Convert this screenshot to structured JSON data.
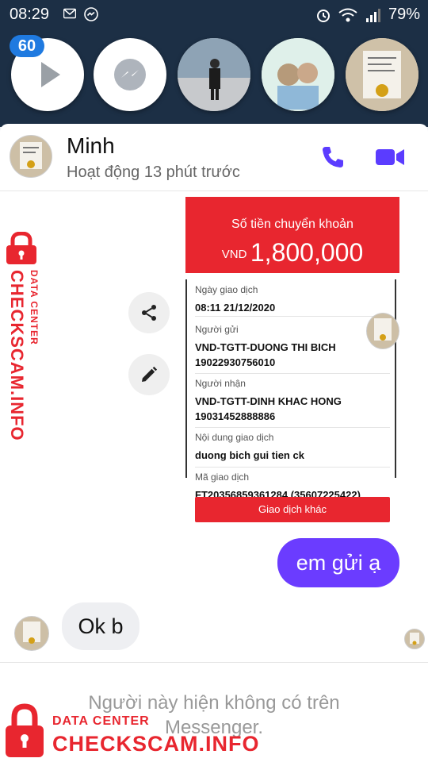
{
  "status_bar": {
    "time": "08:29",
    "battery": "79%"
  },
  "chat_heads": {
    "badge_count": "60"
  },
  "conversation": {
    "contact_name": "Minh",
    "contact_status": "Hoạt động 13 phút trước"
  },
  "receipt": {
    "title": "Số tiền chuyển khoản",
    "currency": "VND",
    "amount": "1,800,000",
    "fields": [
      {
        "label": "Ngày giao dịch",
        "value": "08:11 21/12/2020"
      },
      {
        "label": "Người gửi",
        "value": "VND-TGTT-DUONG THI BICH",
        "value2": "19022930756010"
      },
      {
        "label": "Người nhận",
        "value": "VND-TGTT-DINH KHAC HONG",
        "value2": "19031452888886"
      },
      {
        "label": "Nội dung giao dịch",
        "value": "duong bich gui tien ck"
      },
      {
        "label": "Mã giao dịch",
        "value": "FT20356859361284 (35607225422)"
      }
    ],
    "button_label": "Giao dịch khác"
  },
  "messages": {
    "outgoing": "em gửi ạ",
    "incoming": "Ok b"
  },
  "footer": {
    "notice": "Người này hiện không có trên Messenger."
  },
  "watermark": {
    "small_text": "DATA CENTER",
    "big_text": "CHECKSCAM.INFO"
  },
  "colors": {
    "messenger_purple": "#6b3cff",
    "receipt_red": "#e8262f",
    "action_icon": "#5b3cff"
  }
}
